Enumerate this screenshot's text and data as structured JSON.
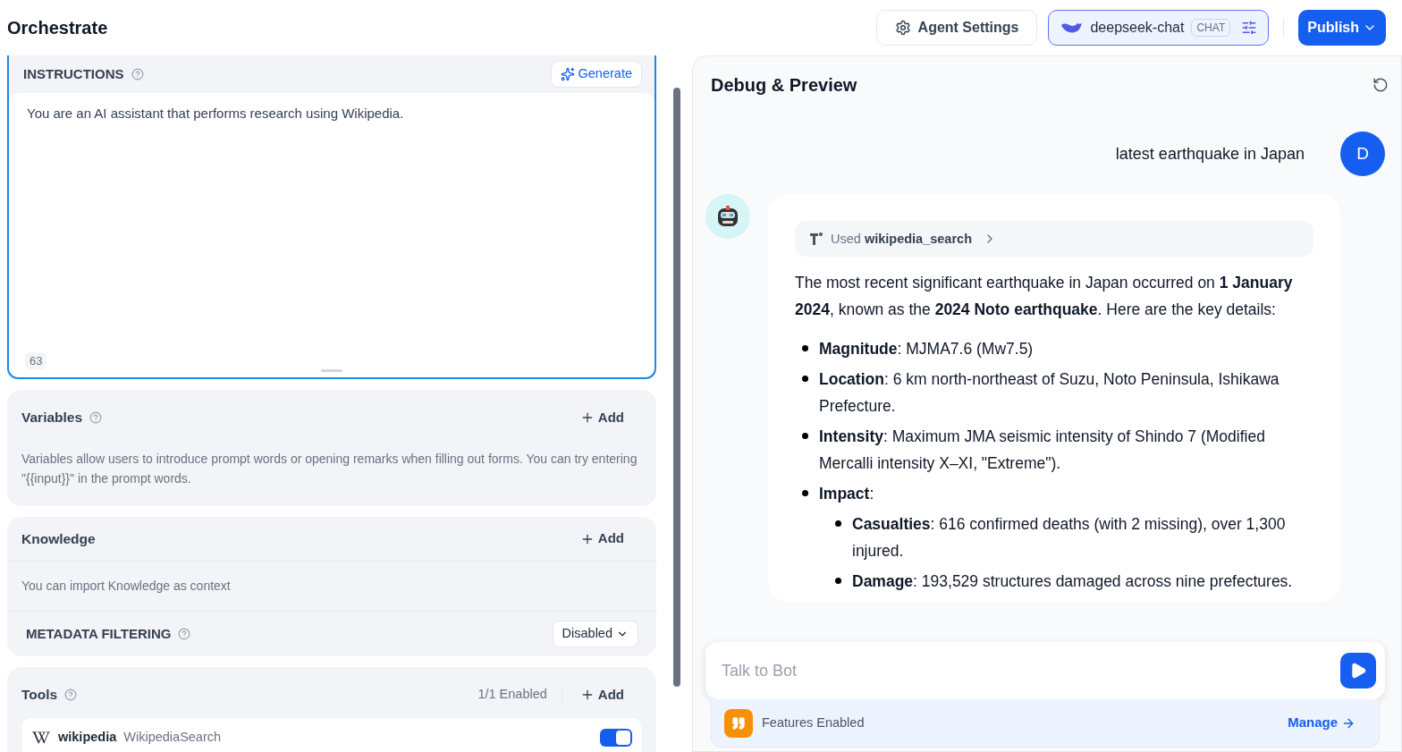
{
  "header": {
    "title": "Orchestrate",
    "agent_settings": "Agent Settings",
    "model": {
      "name": "deepseek-chat",
      "badge": "CHAT"
    },
    "publish": "Publish"
  },
  "instructions": {
    "title": "INSTRUCTIONS",
    "generate": "Generate",
    "text": "You are an AI assistant that performs research using Wikipedia.",
    "count": "63"
  },
  "variables": {
    "title": "Variables",
    "add": "Add",
    "description": "Variables allow users to introduce prompt words or opening remarks when filling out forms. You can try entering \"{{input}}\" in the prompt words."
  },
  "knowledge": {
    "title": "Knowledge",
    "add": "Add",
    "description": "You can import Knowledge as context",
    "metadata_label": "METADATA FILTERING",
    "metadata_value": "Disabled"
  },
  "tools": {
    "title": "Tools",
    "status": "1/1 Enabled",
    "add": "Add",
    "items": [
      {
        "name": "wikipedia",
        "label": "WikipediaSearch",
        "on": true
      }
    ]
  },
  "debug": {
    "title": "Debug & Preview",
    "messages": [
      {
        "kind": "user",
        "text": "latest earthquake in Japan",
        "avatar": "D"
      },
      {
        "kind": "bot",
        "tool_call": {
          "prefix": "Used",
          "name": "wikipedia_search"
        },
        "paragraph": "The most recent significant earthquake in Japan occurred on **1 January 2024**, known as the **2024 Noto earthquake**. Here are the key details:",
        "bullets": [
          {
            "text": "**Magnitude**: MJMA7.6 (Mw7.5)"
          },
          {
            "text": "**Location**: 6 km north-northeast of Suzu, Noto Peninsula, Ishikawa Prefecture."
          },
          {
            "text": "**Intensity**: Maximum JMA seismic intensity of Shindo 7 (Modified Mercalli intensity X–XI, \"Extreme\")."
          },
          {
            "text": "**Impact**:",
            "children": [
              {
                "text": "**Casualties**: 616 confirmed deaths (with 2 missing), over 1,300 injured."
              },
              {
                "text": "**Damage**: 193,529 structures damaged across nine prefectures."
              }
            ]
          }
        ]
      }
    ],
    "input_placeholder": "Talk to Bot",
    "features": {
      "label": "Features Enabled",
      "manage": "Manage"
    }
  }
}
